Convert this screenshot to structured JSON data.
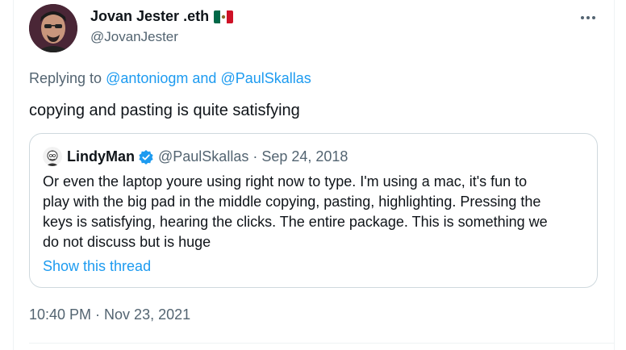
{
  "tweet": {
    "author": {
      "name": "Jovan Jester .eth",
      "handle": "@JovanJester",
      "flag_icon": "mexico-flag-icon"
    },
    "more_icon": "more-horizontal-icon",
    "replying": {
      "prefix": "Replying to ",
      "user1": "@antoniogm",
      "conjunction": " and ",
      "user2": "@PaulSkallas"
    },
    "text": "copying and pasting is quite satisfying",
    "timestamp": "10:40 PM · Nov 23, 2021"
  },
  "quote": {
    "name": "LindyMan",
    "verified_icon": "verified-badge-icon",
    "meta": "@PaulSkallas · Sep 24, 2018",
    "lines": [
      "Or even the laptop youre using right now to type. I'm using a mac, it's fun to",
      "play with the big pad in the middle copying, pasting, highlighting. Pressing the",
      "keys is satisfying, hearing the clicks. The entire package. This is something we",
      "do not discuss but is huge"
    ],
    "show_thread": "Show this thread"
  },
  "colors": {
    "accent": "#1d9bf0",
    "text": "#0f1419",
    "secondary": "#536471",
    "border": "#cfd9de"
  }
}
